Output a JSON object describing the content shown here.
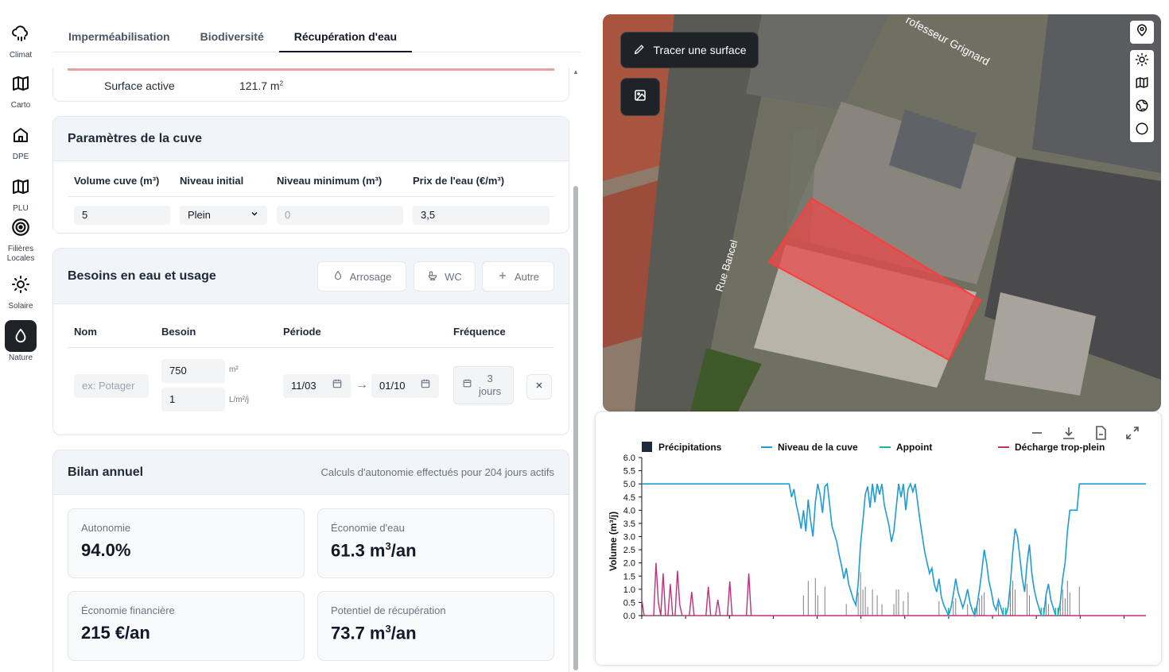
{
  "rail": [
    {
      "label": "Climat",
      "icon": "cloud-rain-icon"
    },
    {
      "label": "Carto",
      "icon": "map-icon"
    },
    {
      "label": "DPE",
      "icon": "house-icon"
    },
    {
      "label": "PLU",
      "icon": "map-icon"
    },
    {
      "label": "Filières Locales",
      "icon": "target-icon"
    },
    {
      "label": "Solaire",
      "icon": "sun-icon"
    },
    {
      "label": "Nature",
      "icon": "droplet-icon",
      "active": true
    }
  ],
  "tabs": [
    {
      "label": "Imperméabilisation"
    },
    {
      "label": "Biodiversité"
    },
    {
      "label": "Récupération d'eau",
      "active": true
    }
  ],
  "surface": {
    "label": "Surface active",
    "value": "121.7 m",
    "unit_sup": "2"
  },
  "cuve": {
    "title": "Paramètres de la cuve",
    "col_volume": "Volume cuve (m³)",
    "col_niveau": "Niveau initial",
    "col_min": "Niveau minimum (m³)",
    "col_prix": "Prix de l'eau (€/m³)",
    "volume": "5",
    "niveau": "Plein",
    "min_placeholder": "0",
    "prix": "3,5"
  },
  "besoins": {
    "title": "Besoins en eau et usage",
    "btn_arrosage": "Arrosage",
    "btn_wc": "WC",
    "btn_autre": "Autre",
    "col_nom": "Nom",
    "col_besoin": "Besoin",
    "col_periode": "Période",
    "col_frequence": "Fréquence",
    "nom_placeholder": "ex: Potager",
    "besoin_surface": "750",
    "besoin_surface_unit": "m²",
    "besoin_dose": "1",
    "besoin_dose_unit": "L/m²/j",
    "date_start": "11/03",
    "date_end": "01/10",
    "arrow": "→",
    "freq_value": "3",
    "freq_unit": "jours"
  },
  "bilan": {
    "title": "Bilan annuel",
    "subtitle": "Calculs d'autonomie effectués pour 204 jours actifs",
    "stats": [
      {
        "label": "Autonomie",
        "value": "94.0%"
      },
      {
        "label": "Économie d'eau",
        "value": "61.3 m",
        "sup": "3",
        "suffix": "/an"
      },
      {
        "label": "Économie financière",
        "value": "215 €/an"
      },
      {
        "label": "Potentiel de récupération",
        "value": "73.7 m",
        "sup": "3",
        "suffix": "/an"
      }
    ]
  },
  "map": {
    "trace_label": "Tracer une surface",
    "street_1": "Rue Bancel",
    "street_2": "rofesseur Grignard",
    "tools": [
      "location-pin-icon",
      "sun-icon",
      "map-icon",
      "globe-icon",
      "circle-icon"
    ]
  },
  "chart_data": {
    "type": "line",
    "ylabel": "Volume (m³/j)",
    "ylim": [
      0,
      6.0
    ],
    "yticks": [
      "0.0",
      "0.5",
      "1.0",
      "1.5",
      "2.0",
      "2.5",
      "3.0",
      "3.5",
      "4.0",
      "4.5",
      "5.0",
      "5.5",
      "6.0"
    ],
    "legend": [
      "Précipitations",
      "Niveau de la cuve",
      "Appoint",
      "Décharge trop-plein"
    ],
    "colors": {
      "precip": "#1e293b",
      "niveau": "#1f9bd6",
      "appoint": "#14b8a6",
      "decharge": "#c0307a"
    },
    "series": [
      {
        "name": "Niveau de la cuve",
        "values": [
          5.0,
          5.0,
          5.0,
          5.0,
          5.0,
          5.0,
          5.0,
          5.0,
          5.0,
          5.0,
          5.0,
          5.0,
          5.0,
          5.0,
          5.0,
          5.0,
          5.0,
          5.0,
          5.0,
          5.0,
          5.0,
          5.0,
          5.0,
          5.0,
          5.0,
          5.0,
          5.0,
          5.0,
          5.0,
          5.0,
          5.0,
          5.0,
          5.0,
          5.0,
          5.0,
          5.0,
          5.0,
          5.0,
          5.0,
          5.0,
          5.0,
          5.0,
          5.0,
          5.0,
          5.0,
          5.0,
          5.0,
          5.0,
          5.0,
          5.0,
          5.0,
          5.0,
          5.0,
          5.0,
          5.0,
          5.0,
          5.0,
          5.0,
          5.0,
          5.0,
          5.0,
          5.0,
          5.0,
          4.5,
          4.8,
          4.2,
          3.8,
          3.3,
          4.0,
          3.2,
          4.4,
          3.6,
          3.0,
          4.3,
          5.0,
          4.6,
          3.9,
          4.9,
          5.0,
          4.2,
          3.4,
          3.1,
          2.8,
          2.3,
          1.9,
          1.4,
          1.8,
          1.2,
          0.9,
          0.6,
          0.4,
          1.2,
          2.7,
          3.6,
          4.6,
          4.9,
          4.1,
          5.0,
          4.3,
          5.0,
          4.6,
          5.0,
          4.2,
          3.8,
          3.4,
          2.8,
          3.2,
          4.1,
          5.0,
          4.5,
          5.0,
          4.0,
          4.8,
          5.0,
          4.7,
          5.0,
          4.3,
          3.6,
          3.0,
          2.4,
          2.0,
          1.6,
          1.8,
          1.2,
          0.9,
          1.4,
          0.7,
          0.4,
          0.2,
          0.0,
          0.3,
          0.8,
          1.4,
          0.9,
          0.6,
          0.3,
          0.6,
          1.0,
          0.5,
          0.2,
          0.0,
          0.4,
          1.0,
          1.7,
          2.5,
          2.0,
          1.3,
          0.9,
          0.4,
          0.2,
          0.6,
          0.3,
          0.0,
          0.0,
          0.3,
          1.2,
          2.4,
          3.3,
          3.0,
          2.2,
          1.4,
          0.9,
          2.0,
          2.7,
          1.6,
          1.0,
          0.6,
          0.3,
          0.0,
          0.0,
          0.8,
          1.2,
          0.6,
          0.3,
          0.0,
          0.0,
          0.5,
          1.4,
          2.0,
          3.2,
          4.0,
          4.0,
          4.0,
          4.0,
          5.0,
          5.0,
          5.0,
          5.0,
          5.0,
          5.0,
          5.0,
          5.0,
          5.0,
          5.0,
          5.0,
          5.0,
          5.0,
          5.0,
          5.0,
          5.0,
          5.0,
          5.0,
          5.0,
          5.0,
          5.0,
          5.0,
          5.0,
          5.0,
          5.0,
          5.0,
          5.0,
          5.0,
          5.0
        ]
      },
      {
        "name": "Décharge trop-plein",
        "values": [
          0.6,
          0.0,
          0.0,
          0.0,
          0.0,
          0.0,
          2.0,
          0.5,
          0.0,
          1.6,
          0.0,
          0.0,
          1.2,
          0.0,
          0.0,
          1.7,
          0.4,
          0.0,
          0.0,
          0.0,
          0.0,
          0.9,
          0.0,
          0.0,
          0.0,
          0.0,
          0.0,
          0.0,
          1.1,
          0.0,
          0.0,
          0.0,
          0.6,
          0.0,
          0.0,
          0.0,
          0.0,
          1.3,
          0.0,
          0.0,
          0.0,
          0.0,
          0.0,
          0.0,
          0.0,
          1.6,
          0.0,
          0.0,
          0.0,
          0.0,
          0.0,
          0.0,
          0.0,
          0.0,
          0.0,
          0.0,
          0.0,
          0.0,
          0.0,
          0.0,
          0.0,
          0.0,
          0.0,
          0.0,
          0.0,
          0.0,
          0.0,
          0.0,
          0.0,
          0.0,
          0.0,
          0.0,
          0.0,
          0.0,
          0.0,
          0.0,
          0.0,
          0.0,
          0.0,
          0.0,
          0.0,
          0.0,
          0.0,
          0.0,
          0.0,
          0.0,
          0.0,
          0.0,
          0.0,
          0.0,
          0.0,
          0.0,
          0.0,
          0.0,
          0.0,
          0.0,
          0.0,
          0.0,
          0.0,
          0.0,
          0.0,
          0.0,
          0.0,
          0.0,
          0.0,
          0.0,
          0.0,
          0.0,
          0.0,
          0.0,
          0.0,
          0.0,
          0.0,
          0.0,
          0.0,
          0.0,
          0.0,
          0.0,
          0.0,
          0.0,
          0.0,
          0.0,
          0.0,
          0.0,
          0.0,
          0.0,
          0.0,
          0.0,
          0.0,
          0.0,
          0.0,
          0.0,
          0.0,
          0.0,
          0.0,
          0.0,
          0.0,
          0.0,
          0.0,
          0.0,
          0.0,
          0.0,
          0.0,
          0.0,
          0.0,
          0.0,
          0.0,
          0.0,
          0.0,
          0.0,
          0.0,
          0.0,
          0.0,
          0.0,
          0.0,
          0.0,
          0.0,
          0.0,
          0.0,
          0.0,
          0.0,
          0.0,
          0.0,
          0.0,
          0.0,
          0.0,
          0.0,
          0.0,
          0.0,
          0.0,
          0.0,
          0.0,
          0.0,
          0.0,
          0.0,
          0.0,
          0.0,
          0.0,
          0.0,
          0.0,
          0.0,
          0.0,
          0.0,
          0.0,
          0.0,
          0.0,
          0.0,
          0.0,
          0.0,
          0.0,
          0.0,
          0.0,
          0.0,
          0.0,
          0.0,
          0.0,
          0.0,
          0.0,
          0.0,
          0.0,
          0.0,
          0.0,
          0.0,
          0.0,
          0.0,
          0.0,
          0.0,
          0.0,
          0.0,
          0.0,
          0.0,
          0.0,
          0.0
        ]
      }
    ]
  }
}
